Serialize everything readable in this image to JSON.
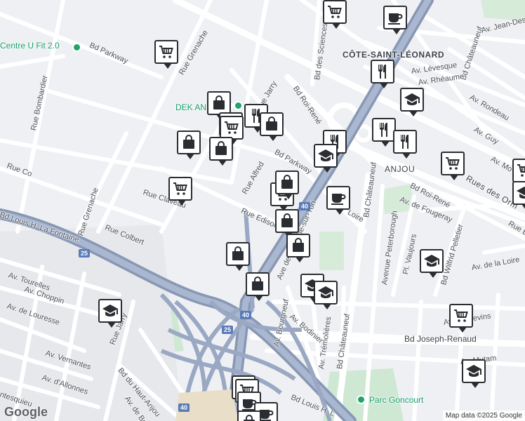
{
  "attribution": "Map data ©2025 Google",
  "brand": "Google",
  "labels": {
    "centre_ufit": "Centre U Fit 2.0",
    "dek_an": "DEK AN",
    "cote_saint_leonard": "CÔTE-SAINT-LÉONARD",
    "anjou": "ANJOU",
    "parc_goncourt": "Parc Goncourt",
    "bd_parkway_w": "Bd Parkway",
    "bd_parkway_e": "Bd Parkway",
    "rue_grenache_n": "Rue Grenache",
    "rue_grenache_s": "Rue Grenache",
    "rue_bombardier": "Rue Bombardier",
    "rue_jarry_n": "Rue Jarry",
    "rue_jarry_s": "Rue Jarry",
    "bd_des_sciences": "Bd des Sciences",
    "bd_roi_rene_n": "Bd Roi-René",
    "bd_roi_rene_e": "Bd Roi-René",
    "rue_alfred": "Rue Alfred",
    "rue_claveau": "Rue Claveau",
    "rue_colbert": "Rue Colbert",
    "rue_co": "Rue Co",
    "rue_edison": "Rue Edison",
    "ave_de_la_roche_sur_yon": "Ave de la Roche-sur-Yon",
    "loire": "Loire",
    "bd_lafontaine": "Bd Louis H. La Fontaine",
    "bd_lafontaine_s": "Bd Louis H. L",
    "av_tourelles": "Av. Tourelles",
    "av_choppin": "Av. Choppin",
    "av_de_louresse": "Av. de Louresse",
    "av_vernantes": "Av. Vernantes",
    "av_dallonnes": "Av. d'Allonnes",
    "bd_du_haut_anjou": "Bd du Haut-Anjou",
    "av_de_belfroy": "Av. de Belfroy",
    "ntesquieu": "ntesquieu",
    "av_bourgneuf": "Av. Bourgneuf",
    "av_bodinier": "Av. Bodinier",
    "av_tremolieres": "Av. Trémolières",
    "bd_chateauneuf_s": "Bd Châteauneuf",
    "bd_chateauneuf_n": "Bd Châteauneuf",
    "bd_chateauneuf_ne": "Bd Châteauneuf",
    "av_de_fougeray": "Av. de Fougeray",
    "avenue_peterborough": "Avenue Peterborough",
    "pl_vaujours": "Pl. Vaujours",
    "bd_wilfrid_pelletier": "Bd Wilfrid Pelletier",
    "av_de_la_loire": "Av. de la Loire",
    "av_langevins": "Av. Langevins",
    "bd_joseph_renaud": "Bd Joseph-Renaud",
    "av_mutam": "Av. Mutam",
    "av_jean_desprez": "Av. Jean-Desprez",
    "av_levesque": "Av. Lévesque",
    "av_rheaume": "Av. Rhéaume",
    "av_rondeau": "Av. Rondeau",
    "av_guy": "Av. Guy",
    "av_mo": "Av. Mo",
    "rues_des_orm": "Rues des Orm",
    "rue_b": "Rue B"
  },
  "shields": {
    "a25_a": "25",
    "a25_b": "25",
    "a40_a": "40",
    "a40_b": "40",
    "a40_c": "40"
  },
  "pins": [
    {
      "type": "cart",
      "name": "shopping-cart-pin"
    },
    {
      "type": "bag",
      "name": "shopping-bag-pin"
    },
    {
      "type": "cart",
      "name": "shopping-cart-pin"
    },
    {
      "type": "bag",
      "name": "shopping-bag-pin"
    },
    {
      "type": "cart",
      "name": "shopping-cart-pin"
    },
    {
      "type": "bag",
      "name": "shopping-bag-pin"
    },
    {
      "type": "fork",
      "name": "restaurant-pin"
    },
    {
      "type": "bag",
      "name": "shopping-bag-pin"
    },
    {
      "type": "cart",
      "name": "shopping-cart-pin"
    },
    {
      "type": "bag",
      "name": "shopping-bag-pin"
    },
    {
      "type": "cart",
      "name": "shopping-cart-pin"
    },
    {
      "type": "bag",
      "name": "shopping-bag-pin"
    },
    {
      "type": "bag",
      "name": "shopping-bag-pin"
    },
    {
      "type": "bag",
      "name": "shopping-bag-pin"
    },
    {
      "type": "bag",
      "name": "shopping-bag-pin"
    },
    {
      "type": "cart",
      "name": "shopping-cart-pin"
    },
    {
      "type": "cup",
      "name": "cafe-pin"
    },
    {
      "type": "fork",
      "name": "restaurant-pin"
    },
    {
      "type": "school",
      "name": "school-pin"
    },
    {
      "type": "fork",
      "name": "restaurant-pin"
    },
    {
      "type": "cup",
      "name": "cafe-pin"
    },
    {
      "type": "fork",
      "name": "restaurant-pin"
    },
    {
      "type": "fork",
      "name": "restaurant-pin"
    },
    {
      "type": "school",
      "name": "school-pin"
    },
    {
      "type": "cart",
      "name": "shopping-cart-pin"
    },
    {
      "type": "cart",
      "name": "shopping-cart-pin"
    },
    {
      "type": "cart",
      "name": "shopping-cart-pin"
    },
    {
      "type": "school",
      "name": "school-pin"
    },
    {
      "type": "school",
      "name": "school-pin"
    },
    {
      "type": "school",
      "name": "school-pin"
    },
    {
      "type": "school",
      "name": "school-pin"
    },
    {
      "type": "cart",
      "name": "shopping-cart-pin"
    },
    {
      "type": "school",
      "name": "school-pin"
    },
    {
      "type": "school",
      "name": "school-pin"
    },
    {
      "type": "cart",
      "name": "shopping-cart-pin"
    },
    {
      "type": "cup",
      "name": "cafe-pin"
    },
    {
      "type": "cup",
      "name": "cafe-pin"
    },
    {
      "type": "bag",
      "name": "shopping-bag-pin"
    }
  ]
}
